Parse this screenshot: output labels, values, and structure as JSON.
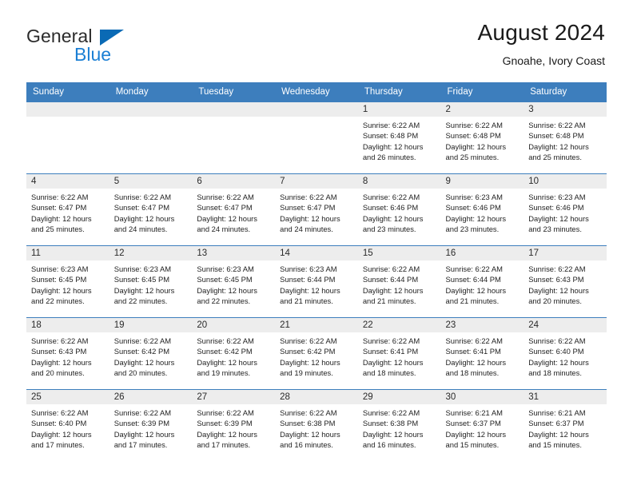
{
  "logo": {
    "word_one": "General",
    "word_two": "Blue",
    "triangle_icon": "triangle-icon",
    "blue": "#1b7fd4"
  },
  "header": {
    "title": "August 2024",
    "subtitle": "Gnoahe, Ivory Coast"
  },
  "colors": {
    "header_blue": "#3d7ebd",
    "daynum_band": "#ededed",
    "text": "#1f1f1f"
  },
  "weekdays": [
    "Sunday",
    "Monday",
    "Tuesday",
    "Wednesday",
    "Thursday",
    "Friday",
    "Saturday"
  ],
  "weeks": [
    [
      {
        "day": "",
        "sunrise": "",
        "sunset": "",
        "daylight_1": "",
        "daylight_2": ""
      },
      {
        "day": "",
        "sunrise": "",
        "sunset": "",
        "daylight_1": "",
        "daylight_2": ""
      },
      {
        "day": "",
        "sunrise": "",
        "sunset": "",
        "daylight_1": "",
        "daylight_2": ""
      },
      {
        "day": "",
        "sunrise": "",
        "sunset": "",
        "daylight_1": "",
        "daylight_2": ""
      },
      {
        "day": "1",
        "sunrise": "Sunrise: 6:22 AM",
        "sunset": "Sunset: 6:48 PM",
        "daylight_1": "Daylight: 12 hours",
        "daylight_2": "and 26 minutes."
      },
      {
        "day": "2",
        "sunrise": "Sunrise: 6:22 AM",
        "sunset": "Sunset: 6:48 PM",
        "daylight_1": "Daylight: 12 hours",
        "daylight_2": "and 25 minutes."
      },
      {
        "day": "3",
        "sunrise": "Sunrise: 6:22 AM",
        "sunset": "Sunset: 6:48 PM",
        "daylight_1": "Daylight: 12 hours",
        "daylight_2": "and 25 minutes."
      }
    ],
    [
      {
        "day": "4",
        "sunrise": "Sunrise: 6:22 AM",
        "sunset": "Sunset: 6:47 PM",
        "daylight_1": "Daylight: 12 hours",
        "daylight_2": "and 25 minutes."
      },
      {
        "day": "5",
        "sunrise": "Sunrise: 6:22 AM",
        "sunset": "Sunset: 6:47 PM",
        "daylight_1": "Daylight: 12 hours",
        "daylight_2": "and 24 minutes."
      },
      {
        "day": "6",
        "sunrise": "Sunrise: 6:22 AM",
        "sunset": "Sunset: 6:47 PM",
        "daylight_1": "Daylight: 12 hours",
        "daylight_2": "and 24 minutes."
      },
      {
        "day": "7",
        "sunrise": "Sunrise: 6:22 AM",
        "sunset": "Sunset: 6:47 PM",
        "daylight_1": "Daylight: 12 hours",
        "daylight_2": "and 24 minutes."
      },
      {
        "day": "8",
        "sunrise": "Sunrise: 6:22 AM",
        "sunset": "Sunset: 6:46 PM",
        "daylight_1": "Daylight: 12 hours",
        "daylight_2": "and 23 minutes."
      },
      {
        "day": "9",
        "sunrise": "Sunrise: 6:23 AM",
        "sunset": "Sunset: 6:46 PM",
        "daylight_1": "Daylight: 12 hours",
        "daylight_2": "and 23 minutes."
      },
      {
        "day": "10",
        "sunrise": "Sunrise: 6:23 AM",
        "sunset": "Sunset: 6:46 PM",
        "daylight_1": "Daylight: 12 hours",
        "daylight_2": "and 23 minutes."
      }
    ],
    [
      {
        "day": "11",
        "sunrise": "Sunrise: 6:23 AM",
        "sunset": "Sunset: 6:45 PM",
        "daylight_1": "Daylight: 12 hours",
        "daylight_2": "and 22 minutes."
      },
      {
        "day": "12",
        "sunrise": "Sunrise: 6:23 AM",
        "sunset": "Sunset: 6:45 PM",
        "daylight_1": "Daylight: 12 hours",
        "daylight_2": "and 22 minutes."
      },
      {
        "day": "13",
        "sunrise": "Sunrise: 6:23 AM",
        "sunset": "Sunset: 6:45 PM",
        "daylight_1": "Daylight: 12 hours",
        "daylight_2": "and 22 minutes."
      },
      {
        "day": "14",
        "sunrise": "Sunrise: 6:23 AM",
        "sunset": "Sunset: 6:44 PM",
        "daylight_1": "Daylight: 12 hours",
        "daylight_2": "and 21 minutes."
      },
      {
        "day": "15",
        "sunrise": "Sunrise: 6:22 AM",
        "sunset": "Sunset: 6:44 PM",
        "daylight_1": "Daylight: 12 hours",
        "daylight_2": "and 21 minutes."
      },
      {
        "day": "16",
        "sunrise": "Sunrise: 6:22 AM",
        "sunset": "Sunset: 6:44 PM",
        "daylight_1": "Daylight: 12 hours",
        "daylight_2": "and 21 minutes."
      },
      {
        "day": "17",
        "sunrise": "Sunrise: 6:22 AM",
        "sunset": "Sunset: 6:43 PM",
        "daylight_1": "Daylight: 12 hours",
        "daylight_2": "and 20 minutes."
      }
    ],
    [
      {
        "day": "18",
        "sunrise": "Sunrise: 6:22 AM",
        "sunset": "Sunset: 6:43 PM",
        "daylight_1": "Daylight: 12 hours",
        "daylight_2": "and 20 minutes."
      },
      {
        "day": "19",
        "sunrise": "Sunrise: 6:22 AM",
        "sunset": "Sunset: 6:42 PM",
        "daylight_1": "Daylight: 12 hours",
        "daylight_2": "and 20 minutes."
      },
      {
        "day": "20",
        "sunrise": "Sunrise: 6:22 AM",
        "sunset": "Sunset: 6:42 PM",
        "daylight_1": "Daylight: 12 hours",
        "daylight_2": "and 19 minutes."
      },
      {
        "day": "21",
        "sunrise": "Sunrise: 6:22 AM",
        "sunset": "Sunset: 6:42 PM",
        "daylight_1": "Daylight: 12 hours",
        "daylight_2": "and 19 minutes."
      },
      {
        "day": "22",
        "sunrise": "Sunrise: 6:22 AM",
        "sunset": "Sunset: 6:41 PM",
        "daylight_1": "Daylight: 12 hours",
        "daylight_2": "and 18 minutes."
      },
      {
        "day": "23",
        "sunrise": "Sunrise: 6:22 AM",
        "sunset": "Sunset: 6:41 PM",
        "daylight_1": "Daylight: 12 hours",
        "daylight_2": "and 18 minutes."
      },
      {
        "day": "24",
        "sunrise": "Sunrise: 6:22 AM",
        "sunset": "Sunset: 6:40 PM",
        "daylight_1": "Daylight: 12 hours",
        "daylight_2": "and 18 minutes."
      }
    ],
    [
      {
        "day": "25",
        "sunrise": "Sunrise: 6:22 AM",
        "sunset": "Sunset: 6:40 PM",
        "daylight_1": "Daylight: 12 hours",
        "daylight_2": "and 17 minutes."
      },
      {
        "day": "26",
        "sunrise": "Sunrise: 6:22 AM",
        "sunset": "Sunset: 6:39 PM",
        "daylight_1": "Daylight: 12 hours",
        "daylight_2": "and 17 minutes."
      },
      {
        "day": "27",
        "sunrise": "Sunrise: 6:22 AM",
        "sunset": "Sunset: 6:39 PM",
        "daylight_1": "Daylight: 12 hours",
        "daylight_2": "and 17 minutes."
      },
      {
        "day": "28",
        "sunrise": "Sunrise: 6:22 AM",
        "sunset": "Sunset: 6:38 PM",
        "daylight_1": "Daylight: 12 hours",
        "daylight_2": "and 16 minutes."
      },
      {
        "day": "29",
        "sunrise": "Sunrise: 6:22 AM",
        "sunset": "Sunset: 6:38 PM",
        "daylight_1": "Daylight: 12 hours",
        "daylight_2": "and 16 minutes."
      },
      {
        "day": "30",
        "sunrise": "Sunrise: 6:21 AM",
        "sunset": "Sunset: 6:37 PM",
        "daylight_1": "Daylight: 12 hours",
        "daylight_2": "and 15 minutes."
      },
      {
        "day": "31",
        "sunrise": "Sunrise: 6:21 AM",
        "sunset": "Sunset: 6:37 PM",
        "daylight_1": "Daylight: 12 hours",
        "daylight_2": "and 15 minutes."
      }
    ]
  ]
}
